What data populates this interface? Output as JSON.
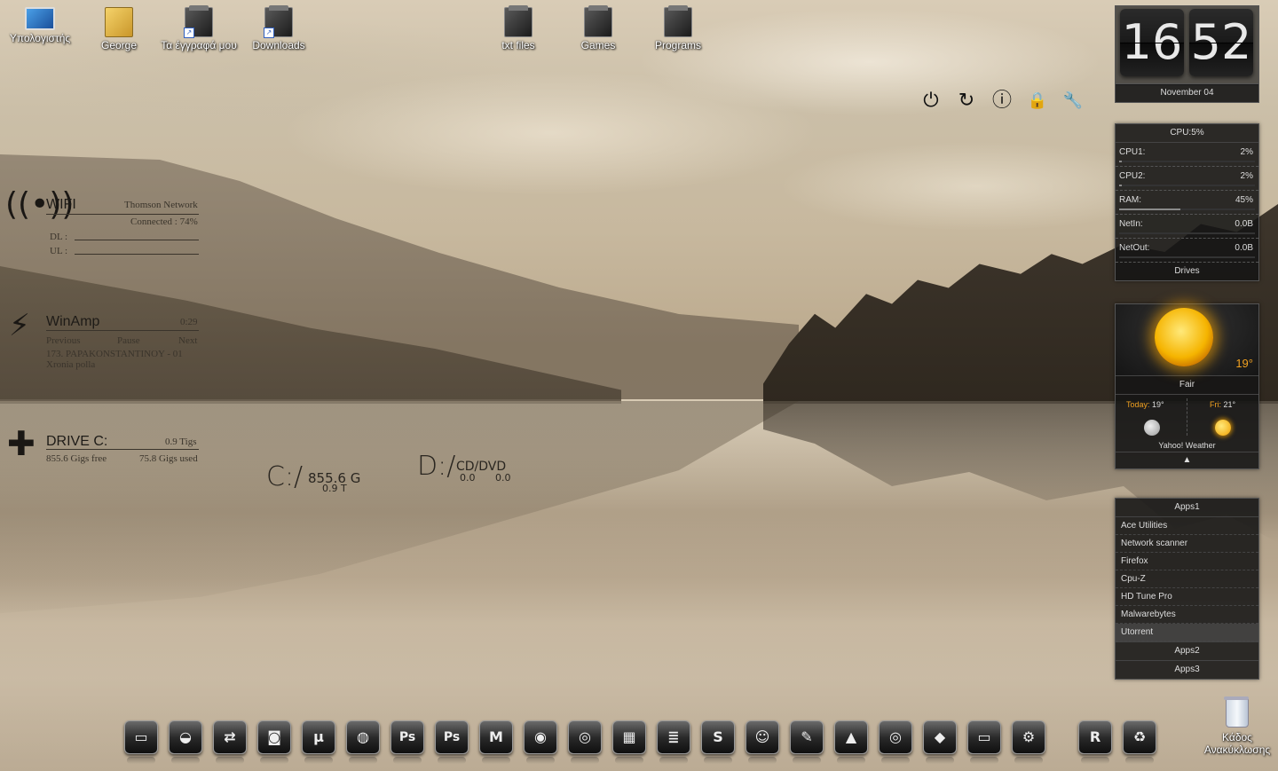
{
  "desktop_icons": [
    {
      "label": "Υπολογιστής",
      "icon": "computer-icon"
    },
    {
      "label": "George",
      "icon": "user-folder-icon"
    },
    {
      "label": "Τα έγγραφά μου",
      "icon": "documents-folder-icon"
    },
    {
      "label": "Downloads",
      "icon": "downloads-folder-icon"
    },
    {
      "label": "txt files",
      "icon": "folder-icon"
    },
    {
      "label": "Games",
      "icon": "folder-icon"
    },
    {
      "label": "Programs",
      "icon": "folder-icon"
    }
  ],
  "power_buttons": [
    {
      "icon": "power-icon",
      "glyph": "⏻"
    },
    {
      "icon": "restart-icon",
      "glyph": "↻"
    },
    {
      "icon": "info-icon",
      "glyph": "ⓘ"
    },
    {
      "icon": "lock-icon",
      "glyph": "🔒"
    },
    {
      "icon": "key-icon",
      "glyph": "🔧"
    }
  ],
  "wifi": {
    "title": "WIFI",
    "network": "Thomson Network",
    "status": "Connected : 74%",
    "dl_label": "DL :",
    "ul_label": "UL :"
  },
  "winamp": {
    "title": "WinAmp",
    "time": "0:29",
    "previous": "Previous",
    "pause": "Pause",
    "next": "Next",
    "track_line1": "173. PAPAKONSTANTINOY - 01",
    "track_line2": "Xronia polla"
  },
  "drive": {
    "title": "DRIVE C:",
    "total": "0.9 Tigs",
    "free": "855.6 Gigs free",
    "used": "75.8 Gigs used"
  },
  "drive_c_big": {
    "letter": "C:/",
    "value": "855.6 G",
    "sub": "0.9 T"
  },
  "drive_d_big": {
    "letter": "D:/",
    "value": "CD/DVD",
    "sub1": "0.0",
    "sub2": "0.0"
  },
  "clock": {
    "hour": "16",
    "minute": "52",
    "date": "November  04"
  },
  "cpu": {
    "header": "CPU:5%",
    "rows": [
      {
        "label": "CPU1:",
        "value": "2%",
        "fill": 0.02
      },
      {
        "label": "CPU2:",
        "value": "2%",
        "fill": 0.02
      },
      {
        "label": "RAM:",
        "value": "45%",
        "fill": 0.45
      },
      {
        "label": "NetIn:",
        "value": "0.0B",
        "fill": 0.0
      },
      {
        "label": "NetOut:",
        "value": "0.0B",
        "fill": 0.0
      }
    ],
    "footer": "Drives"
  },
  "weather": {
    "temp": "19°",
    "condition": "Fair",
    "today_label": "Today:",
    "today_temp": "19°",
    "fri_label": "Fri:",
    "fri_temp": "21°",
    "source": "Yahoo! Weather",
    "arrow": "▲"
  },
  "apps": {
    "header": "Apps1",
    "items": [
      "Ace Utilities",
      "Network scanner",
      "Firefox",
      "Cpu-Z",
      "HD Tune Pro",
      "Malwarebytes",
      "Utorrent"
    ],
    "apps2": "Apps2",
    "apps3": "Apps3"
  },
  "dock": [
    {
      "icon": "computer-icon",
      "glyph": "▭"
    },
    {
      "icon": "disk-icon",
      "glyph": "◒"
    },
    {
      "icon": "network-icon",
      "glyph": "⇄"
    },
    {
      "icon": "camera-icon",
      "glyph": "◙"
    },
    {
      "icon": "utorrent-icon",
      "glyph": "µ"
    },
    {
      "icon": "firefox-icon",
      "glyph": "◍"
    },
    {
      "icon": "photoshop-icon",
      "glyph": "Ps"
    },
    {
      "icon": "photoshop-alt-icon",
      "glyph": "Ps"
    },
    {
      "icon": "malwarebytes-icon",
      "glyph": "M"
    },
    {
      "icon": "media-player-icon",
      "glyph": "◉"
    },
    {
      "icon": "winamp-icon",
      "glyph": "◎"
    },
    {
      "icon": "cube-icon",
      "glyph": "▦"
    },
    {
      "icon": "books-icon",
      "glyph": "≣"
    },
    {
      "icon": "skype-icon",
      "glyph": "S"
    },
    {
      "icon": "messenger-icon",
      "glyph": "☺"
    },
    {
      "icon": "tools-icon",
      "glyph": "✎"
    },
    {
      "icon": "vlc-icon",
      "glyph": "▲"
    },
    {
      "icon": "cd-icon",
      "glyph": "◎"
    },
    {
      "icon": "eraser-icon",
      "glyph": "◆"
    },
    {
      "icon": "drive-icon",
      "glyph": "▭"
    },
    {
      "icon": "settings-icon",
      "glyph": "⚙"
    },
    {
      "icon": "rainmeter-icon",
      "glyph": "R"
    },
    {
      "icon": "recycle-dock-icon",
      "glyph": "♻"
    }
  ],
  "recycle_bin": {
    "label": "Κάδος Ανακύκλωσης"
  }
}
